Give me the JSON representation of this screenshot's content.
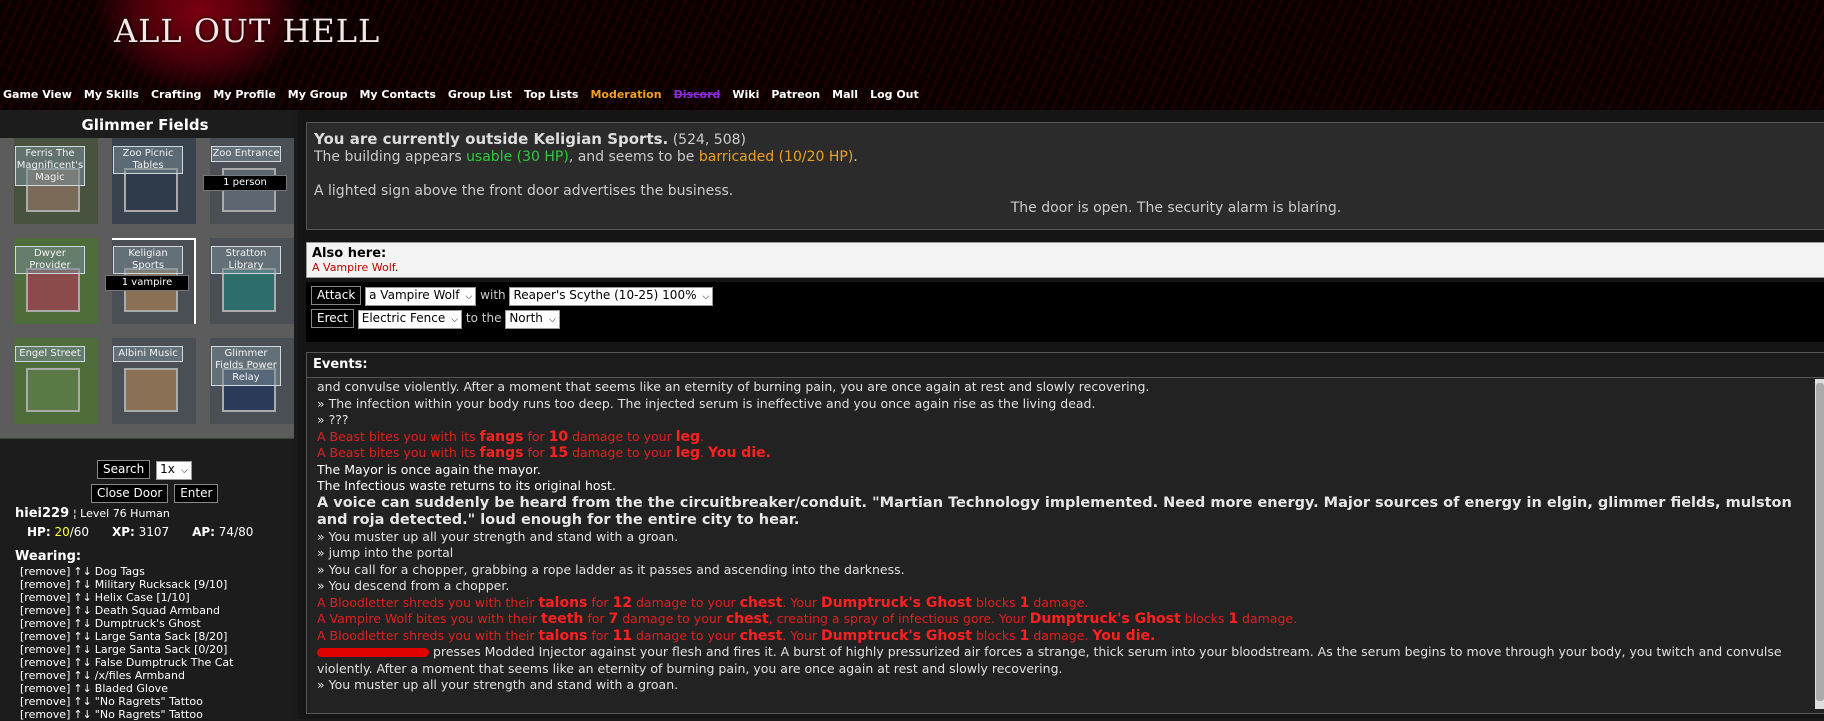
{
  "header": {
    "logo": "ALL OUT HELL",
    "nav": [
      "Game View",
      "My Skills",
      "Crafting",
      "My Profile",
      "My Group",
      "My Contacts",
      "Group List",
      "Top Lists",
      "Moderation",
      "Discord",
      "Wiki",
      "Patreon",
      "Mall",
      "Log Out"
    ],
    "nav_colors": {
      "Moderation": "#f0a020",
      "Discord": "#8a2be2"
    }
  },
  "sidebar": {
    "title": "Glimmer Fields",
    "map": [
      {
        "label": "Ferris The Magnificent's Magic",
        "count": ""
      },
      {
        "label": "Zoo Picnic Tables",
        "count": ""
      },
      {
        "label": "Zoo Entrance",
        "count": "1 person"
      },
      {
        "label": "Dwyer Provider",
        "count": ""
      },
      {
        "label": "Keligian Sports",
        "count": "1 vampire"
      },
      {
        "label": "Stratton Library",
        "count": ""
      },
      {
        "label": "Engel Street",
        "count": ""
      },
      {
        "label": "Albini Music",
        "count": ""
      },
      {
        "label": "Glimmer Fields Power Relay",
        "count": ""
      }
    ],
    "search_button": "Search",
    "search_multiplier": "1x",
    "close_door_button": "Close Door",
    "enter_button": "Enter"
  },
  "player": {
    "name": "hiei229",
    "level_text": "¦ Level 76 Human",
    "hp_label": "HP:",
    "hp_current": "20",
    "hp_max": "/60",
    "xp_label": "XP:",
    "xp_value": "3107",
    "ap_label": "AP:",
    "ap_value": "74/80"
  },
  "wearing": {
    "title": "Wearing:",
    "remove_label": "[remove]",
    "arrows": "↑↓",
    "items": [
      "Dog Tags",
      "Military Rucksack [9/10]",
      "Helix Case [1/10]",
      "Death Squad Armband",
      "Dumptruck's Ghost",
      "Large Santa Sack [8/20]",
      "Large Santa Sack [0/20]",
      "False Dumptruck The Cat",
      "/x/files Armband",
      "Bladed Glove",
      "\"No Ragrets\" Tattoo",
      "\"No Ragrets\" Tattoo"
    ]
  },
  "location": {
    "title": "You are currently outside Keligian Sports.",
    "coords": "(524, 508)",
    "building_prefix": "The building appears ",
    "usable": "usable (30 HP)",
    "mid": ", and seems to be ",
    "barricaded": "barricaded (10/20 HP)",
    "building_suffix": ".",
    "sign": "A lighted sign above the front door advertises the business.",
    "door": "The door is open. The security alarm is blaring.",
    "usable_color": "#2ecc40",
    "barricaded_color": "#f0a020"
  },
  "also_here": {
    "title": "Also here:",
    "entity": "A Vampire Wolf",
    "entity_color": "#c00000"
  },
  "actions": {
    "attack_button": "Attack",
    "target": "a Vampire Wolf",
    "with": "with",
    "weapon": "Reaper's Scythe (10-25) 100%",
    "erect_button": "Erect",
    "structure": "Electric Fence",
    "to_the": "to the",
    "direction": "North"
  },
  "events": {
    "title": "Events:",
    "lines": [
      {
        "t": "and convulse violently. After a moment that seems like an eternity of burning pain, you are once again at rest and slowly recovering."
      },
      {
        "t": "» The infection within your body runs too deep. The injected serum is ineffective and you once again rise as the living dead."
      },
      {
        "t": "» ???"
      },
      {
        "red": true,
        "parts": [
          {
            "t": "A Beast bites you with its "
          },
          {
            "b": "fangs"
          },
          {
            "t": " for "
          },
          {
            "b": "10"
          },
          {
            "t": " damage to your "
          },
          {
            "b": "leg"
          },
          {
            "t": "."
          }
        ]
      },
      {
        "red": true,
        "parts": [
          {
            "t": "A Beast bites you with its "
          },
          {
            "b": "fangs"
          },
          {
            "t": " for "
          },
          {
            "b": "15"
          },
          {
            "t": " damage to your "
          },
          {
            "b": "leg"
          },
          {
            "t": ". "
          },
          {
            "b": "You die."
          }
        ]
      },
      {
        "t": "The Mayor is once again the mayor.",
        "white": true
      },
      {
        "t": "The Infectious waste returns to its original host.",
        "white": true
      },
      {
        "big": true,
        "t": "A voice can suddenly be heard from the the circuitbreaker/conduit. \"Martian Technology implemented. Need more energy. Major sources of energy in elgin, glimmer fields, mulston and roja detected.\" loud enough for the entire city to hear."
      },
      {
        "t": "» You muster up all your strength and stand with a groan."
      },
      {
        "t": "» jump into the portal"
      },
      {
        "t": "» You call for a chopper, grabbing a rope ladder as it passes and ascending into the darkness."
      },
      {
        "t": "» You descend from a chopper."
      },
      {
        "red": true,
        "parts": [
          {
            "t": "A Bloodletter shreds you with their "
          },
          {
            "b": "talons"
          },
          {
            "t": " for "
          },
          {
            "b": "12"
          },
          {
            "t": " damage to your "
          },
          {
            "b": "chest"
          },
          {
            "t": ". Your "
          },
          {
            "b": "Dumptruck's Ghost"
          },
          {
            "t": " blocks "
          },
          {
            "b": "1"
          },
          {
            "t": " damage."
          }
        ]
      },
      {
        "red": true,
        "parts": [
          {
            "t": "A Vampire Wolf bites you with their "
          },
          {
            "b": "teeth"
          },
          {
            "t": " for "
          },
          {
            "b": "7"
          },
          {
            "t": " damage to your "
          },
          {
            "b": "chest"
          },
          {
            "t": ", creating a spray of infectious gore. Your "
          },
          {
            "b": "Dumptruck's Ghost"
          },
          {
            "t": " blocks "
          },
          {
            "b": "1"
          },
          {
            "t": " damage."
          }
        ]
      },
      {
        "red": true,
        "parts": [
          {
            "t": "A Bloodletter shreds you with their "
          },
          {
            "b": "talons"
          },
          {
            "t": " for "
          },
          {
            "b": "11"
          },
          {
            "t": " damage to your "
          },
          {
            "b": "chest"
          },
          {
            "t": ". Your "
          },
          {
            "b": "Dumptruck's Ghost"
          },
          {
            "t": " blocks "
          },
          {
            "b": "1"
          },
          {
            "t": " damage. "
          },
          {
            "b": "You die."
          }
        ]
      },
      {
        "redacted": true,
        "t": " presses Modded Injector against your flesh and fires it. A burst of highly pressurized air forces a strange, thick serum into your bloodstream. As the serum begins to move through your body, you twitch and convulse violently. After a moment that seems like an eternity of burning pain, you are once again at rest and slowly recovering."
      },
      {
        "t": "» You muster up all your strength and stand with a groan."
      }
    ]
  }
}
